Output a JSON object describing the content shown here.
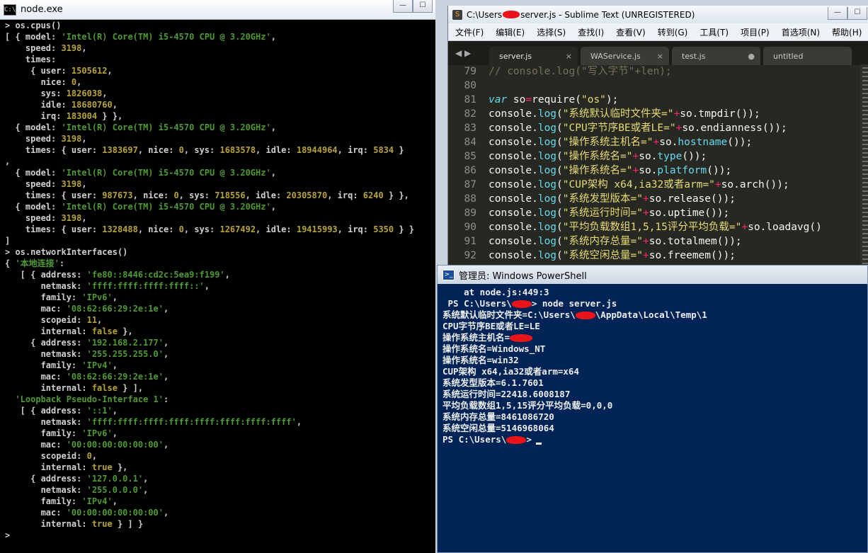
{
  "node_window": {
    "title": "node.exe",
    "lines": [
      [
        [
          "p",
          "> os.cpus()"
        ]
      ],
      [
        [
          "p",
          "[ { model: "
        ],
        [
          "s",
          "'Intel(R) Core(TM) i5-4570 CPU @ 3.20GHz'"
        ],
        [
          "p",
          ","
        ]
      ],
      [
        [
          "p",
          "    speed: "
        ],
        [
          "n",
          "3198"
        ],
        [
          "p",
          ","
        ]
      ],
      [
        [
          "p",
          "    times:"
        ]
      ],
      [
        [
          "p",
          "     { user: "
        ],
        [
          "n",
          "1505612"
        ],
        [
          "p",
          ","
        ]
      ],
      [
        [
          "p",
          "       nice: "
        ],
        [
          "n",
          "0"
        ],
        [
          "p",
          ","
        ]
      ],
      [
        [
          "p",
          "       sys: "
        ],
        [
          "n",
          "1826038"
        ],
        [
          "p",
          ","
        ]
      ],
      [
        [
          "p",
          "       idle: "
        ],
        [
          "n",
          "18680760"
        ],
        [
          "p",
          ","
        ]
      ],
      [
        [
          "p",
          "       irq: "
        ],
        [
          "n",
          "183004"
        ],
        [
          "p",
          " } },"
        ]
      ],
      [
        [
          "p",
          "  { model: "
        ],
        [
          "s",
          "'Intel(R) Core(TM) i5-4570 CPU @ 3.20GHz'"
        ],
        [
          "p",
          ","
        ]
      ],
      [
        [
          "p",
          "    speed: "
        ],
        [
          "n",
          "3198"
        ],
        [
          "p",
          ","
        ]
      ],
      [
        [
          "p",
          "    times: { user: "
        ],
        [
          "n",
          "1383697"
        ],
        [
          "p",
          ", nice: "
        ],
        [
          "n",
          "0"
        ],
        [
          "p",
          ", sys: "
        ],
        [
          "n",
          "1683578"
        ],
        [
          "p",
          ", idle: "
        ],
        [
          "n",
          "18944964"
        ],
        [
          "p",
          ", irq: "
        ],
        [
          "n",
          "5834"
        ],
        [
          "p",
          " }"
        ]
      ],
      [
        [
          "p",
          ","
        ]
      ],
      [
        [
          "p",
          "  { model: "
        ],
        [
          "s",
          "'Intel(R) Core(TM) i5-4570 CPU @ 3.20GHz'"
        ],
        [
          "p",
          ","
        ]
      ],
      [
        [
          "p",
          "    speed: "
        ],
        [
          "n",
          "3198"
        ],
        [
          "p",
          ","
        ]
      ],
      [
        [
          "p",
          "    times: { user: "
        ],
        [
          "n",
          "987673"
        ],
        [
          "p",
          ", nice: "
        ],
        [
          "n",
          "0"
        ],
        [
          "p",
          ", sys: "
        ],
        [
          "n",
          "718556"
        ],
        [
          "p",
          ", idle: "
        ],
        [
          "n",
          "20305870"
        ],
        [
          "p",
          ", irq: "
        ],
        [
          "n",
          "6240"
        ],
        [
          "p",
          " } },"
        ]
      ],
      [
        [
          "p",
          "  { model: "
        ],
        [
          "s",
          "'Intel(R) Core(TM) i5-4570 CPU @ 3.20GHz'"
        ],
        [
          "p",
          ","
        ]
      ],
      [
        [
          "p",
          "    speed: "
        ],
        [
          "n",
          "3198"
        ],
        [
          "p",
          ","
        ]
      ],
      [
        [
          "p",
          "    times: { user: "
        ],
        [
          "n",
          "1328488"
        ],
        [
          "p",
          ", nice: "
        ],
        [
          "n",
          "0"
        ],
        [
          "p",
          ", sys: "
        ],
        [
          "n",
          "1267492"
        ],
        [
          "p",
          ", idle: "
        ],
        [
          "n",
          "19415993"
        ],
        [
          "p",
          ", irq: "
        ],
        [
          "n",
          "5350"
        ],
        [
          "p",
          " } }"
        ]
      ],
      [
        [
          "p",
          "]"
        ]
      ],
      [
        [
          "p",
          "> os.networkInterfaces()"
        ]
      ],
      [
        [
          "p",
          "{ "
        ],
        [
          "s",
          "'本地连接'"
        ],
        [
          "p",
          ":"
        ]
      ],
      [
        [
          "p",
          "   [ { address: "
        ],
        [
          "s",
          "'fe80::8446:cd2c:5ea9:f199'"
        ],
        [
          "p",
          ","
        ]
      ],
      [
        [
          "p",
          "       netmask: "
        ],
        [
          "s",
          "'ffff:ffff:ffff:ffff::'"
        ],
        [
          "p",
          ","
        ]
      ],
      [
        [
          "p",
          "       family: "
        ],
        [
          "s",
          "'IPv6'"
        ],
        [
          "p",
          ","
        ]
      ],
      [
        [
          "p",
          "       mac: "
        ],
        [
          "s",
          "'08:62:66:29:2e:1e'"
        ],
        [
          "p",
          ","
        ]
      ],
      [
        [
          "p",
          "       scopeid: "
        ],
        [
          "n",
          "11"
        ],
        [
          "p",
          ","
        ]
      ],
      [
        [
          "p",
          "       internal: "
        ],
        [
          "b",
          "false"
        ],
        [
          "p",
          " },"
        ]
      ],
      [
        [
          "p",
          "     { address: "
        ],
        [
          "s",
          "'192.168.2.177'"
        ],
        [
          "p",
          ","
        ]
      ],
      [
        [
          "p",
          "       netmask: "
        ],
        [
          "s",
          "'255.255.255.0'"
        ],
        [
          "p",
          ","
        ]
      ],
      [
        [
          "p",
          "       family: "
        ],
        [
          "s",
          "'IPv4'"
        ],
        [
          "p",
          ","
        ]
      ],
      [
        [
          "p",
          "       mac: "
        ],
        [
          "s",
          "'08:62:66:29:2e:1e'"
        ],
        [
          "p",
          ","
        ]
      ],
      [
        [
          "p",
          "       internal: "
        ],
        [
          "b",
          "false"
        ],
        [
          "p",
          " } ],"
        ]
      ],
      [
        [
          "p",
          "  "
        ],
        [
          "s",
          "'Loopback Pseudo-Interface 1'"
        ],
        [
          "p",
          ":"
        ]
      ],
      [
        [
          "p",
          "   [ { address: "
        ],
        [
          "s",
          "'::1'"
        ],
        [
          "p",
          ","
        ]
      ],
      [
        [
          "p",
          "       netmask: "
        ],
        [
          "s",
          "'ffff:ffff:ffff:ffff:ffff:ffff:ffff:ffff'"
        ],
        [
          "p",
          ","
        ]
      ],
      [
        [
          "p",
          "       family: "
        ],
        [
          "s",
          "'IPv6'"
        ],
        [
          "p",
          ","
        ]
      ],
      [
        [
          "p",
          "       mac: "
        ],
        [
          "s",
          "'00:00:00:00:00:00'"
        ],
        [
          "p",
          ","
        ]
      ],
      [
        [
          "p",
          "       scopeid: "
        ],
        [
          "n",
          "0"
        ],
        [
          "p",
          ","
        ]
      ],
      [
        [
          "p",
          "       internal: "
        ],
        [
          "b",
          "true"
        ],
        [
          "p",
          " },"
        ]
      ],
      [
        [
          "p",
          "     { address: "
        ],
        [
          "s",
          "'127.0.0.1'"
        ],
        [
          "p",
          ","
        ]
      ],
      [
        [
          "p",
          "       netmask: "
        ],
        [
          "s",
          "'255.0.0.0'"
        ],
        [
          "p",
          ","
        ]
      ],
      [
        [
          "p",
          "       family: "
        ],
        [
          "s",
          "'IPv4'"
        ],
        [
          "p",
          ","
        ]
      ],
      [
        [
          "p",
          "       mac: "
        ],
        [
          "s",
          "'00:00:00:00:00:00'"
        ],
        [
          "p",
          ","
        ]
      ],
      [
        [
          "p",
          "       internal: "
        ],
        [
          "b",
          "true"
        ],
        [
          "p",
          " } ] }"
        ]
      ],
      [
        [
          "p",
          ">"
        ]
      ]
    ]
  },
  "sublime_window": {
    "title_prefix": "C:\\Users",
    "title_suffix": "server.js - Sublime Text (UNREGISTERED)",
    "menu": [
      "文件(F)",
      "编辑(E)",
      "选择(S)",
      "查找(I)",
      "查看(V)",
      "转到(G)",
      "工具(T)",
      "项目(P)",
      "首选项(N)",
      "帮助(H)"
    ],
    "tabs": [
      {
        "label": "server.js",
        "active": true,
        "marker": "×"
      },
      {
        "label": "WAService.js",
        "active": false,
        "marker": "×"
      },
      {
        "label": "test.js",
        "active": false,
        "marker": "●"
      },
      {
        "label": "untitled",
        "active": false,
        "marker": ""
      }
    ],
    "code": [
      {
        "n": "79",
        "t": [
          [
            "cm",
            "// console.log(\"写入字节\"+len);"
          ]
        ]
      },
      {
        "n": "80",
        "t": []
      },
      {
        "n": "81",
        "t": [
          [
            "kw",
            "var"
          ],
          [
            "tx",
            " so"
          ],
          [
            "op",
            "="
          ],
          [
            "tx",
            "require("
          ],
          [
            "st",
            "\"os\""
          ],
          [
            "tx",
            ");"
          ]
        ]
      },
      {
        "n": "82",
        "t": [
          [
            "tx",
            "console."
          ],
          [
            "fn",
            "log"
          ],
          [
            "tx",
            "("
          ],
          [
            "st",
            "\"系统默认临时文件夹=\""
          ],
          [
            "op",
            "+"
          ],
          [
            "tx",
            "so.tmpdir());"
          ]
        ]
      },
      {
        "n": "83",
        "t": [
          [
            "tx",
            "console."
          ],
          [
            "fn",
            "log"
          ],
          [
            "tx",
            "("
          ],
          [
            "st",
            "\"CPU字节序BE或者LE=\""
          ],
          [
            "op",
            "+"
          ],
          [
            "tx",
            "so.endianness());"
          ]
        ]
      },
      {
        "n": "84",
        "t": [
          [
            "tx",
            "console."
          ],
          [
            "fn",
            "log"
          ],
          [
            "tx",
            "("
          ],
          [
            "st",
            "\"操作系统主机名=\""
          ],
          [
            "op",
            "+"
          ],
          [
            "tx",
            "so."
          ],
          [
            "fn",
            "hostname"
          ],
          [
            "tx",
            "());"
          ]
        ]
      },
      {
        "n": "85",
        "t": [
          [
            "tx",
            "console."
          ],
          [
            "fn",
            "log"
          ],
          [
            "tx",
            "("
          ],
          [
            "st",
            "\"操作系统名=\""
          ],
          [
            "op",
            "+"
          ],
          [
            "tx",
            "so."
          ],
          [
            "fn",
            "type"
          ],
          [
            "tx",
            "());"
          ]
        ]
      },
      {
        "n": "86",
        "t": [
          [
            "tx",
            "console."
          ],
          [
            "fn",
            "log"
          ],
          [
            "tx",
            "("
          ],
          [
            "st",
            "\"操作系统名=\""
          ],
          [
            "op",
            "+"
          ],
          [
            "tx",
            "so."
          ],
          [
            "fn",
            "platform"
          ],
          [
            "tx",
            "());"
          ]
        ]
      },
      {
        "n": "87",
        "t": [
          [
            "tx",
            "console."
          ],
          [
            "fn",
            "log"
          ],
          [
            "tx",
            "("
          ],
          [
            "st",
            "\"CUP架构 x64,ia32或者arm=\""
          ],
          [
            "op",
            "+"
          ],
          [
            "tx",
            "so.arch());"
          ]
        ]
      },
      {
        "n": "88",
        "t": [
          [
            "tx",
            "console."
          ],
          [
            "fn",
            "log"
          ],
          [
            "tx",
            "("
          ],
          [
            "st",
            "\"系统发型版本=\""
          ],
          [
            "op",
            "+"
          ],
          [
            "tx",
            "so.release());"
          ]
        ]
      },
      {
        "n": "89",
        "t": [
          [
            "tx",
            "console."
          ],
          [
            "fn",
            "log"
          ],
          [
            "tx",
            "("
          ],
          [
            "st",
            "\"系统运行时间=\""
          ],
          [
            "op",
            "+"
          ],
          [
            "tx",
            "so.uptime());"
          ]
        ]
      },
      {
        "n": "90",
        "t": [
          [
            "tx",
            "console."
          ],
          [
            "fn",
            "log"
          ],
          [
            "tx",
            "("
          ],
          [
            "st",
            "\"平均负载数组1,5,15评分平均负载=\""
          ],
          [
            "op",
            "+"
          ],
          [
            "tx",
            "so.loadavg()"
          ]
        ]
      },
      {
        "n": "91",
        "t": [
          [
            "tx",
            "console."
          ],
          [
            "fn",
            "log"
          ],
          [
            "tx",
            "("
          ],
          [
            "st",
            "\"系统内存总量=\""
          ],
          [
            "op",
            "+"
          ],
          [
            "tx",
            "so.totalmem());"
          ]
        ]
      },
      {
        "n": "92",
        "t": [
          [
            "tx",
            "console."
          ],
          [
            "fn",
            "log"
          ],
          [
            "tx",
            "("
          ],
          [
            "st",
            "\"系统空闲总量=\""
          ],
          [
            "op",
            "+"
          ],
          [
            "tx",
            "so.freemem());"
          ]
        ]
      }
    ]
  },
  "powershell_window": {
    "title": "管理员: Windows PowerShell",
    "lines": [
      "    at node.js:449:3",
      " PS C:\\Users\\",
      "系统默认临时文件夹=C:\\Users\\",
      "CPU字节序BE或者LE=LE",
      "操作系统主机名=",
      "操作系统名=Windows_NT",
      "操作系统名=win32",
      "CUP架构 x64,ia32或者arm=x64",
      "系统发型版本=6.1.7601",
      "系统运行时间=22418.6008187",
      "平均负载数组1,5,15评分平均负载=0,0,0",
      "系统内存总量=8461086720",
      "系统空闲总量=5146968064",
      "PS C:\\Users\\"
    ],
    "line_suffixes": {
      "1": "> node server.js",
      "2": "\\AppData\\Local\\Temp\\1",
      "13": ">"
    }
  },
  "window_buttons": {
    "minimize": "—",
    "maximize": "☐",
    "close": "✕"
  }
}
